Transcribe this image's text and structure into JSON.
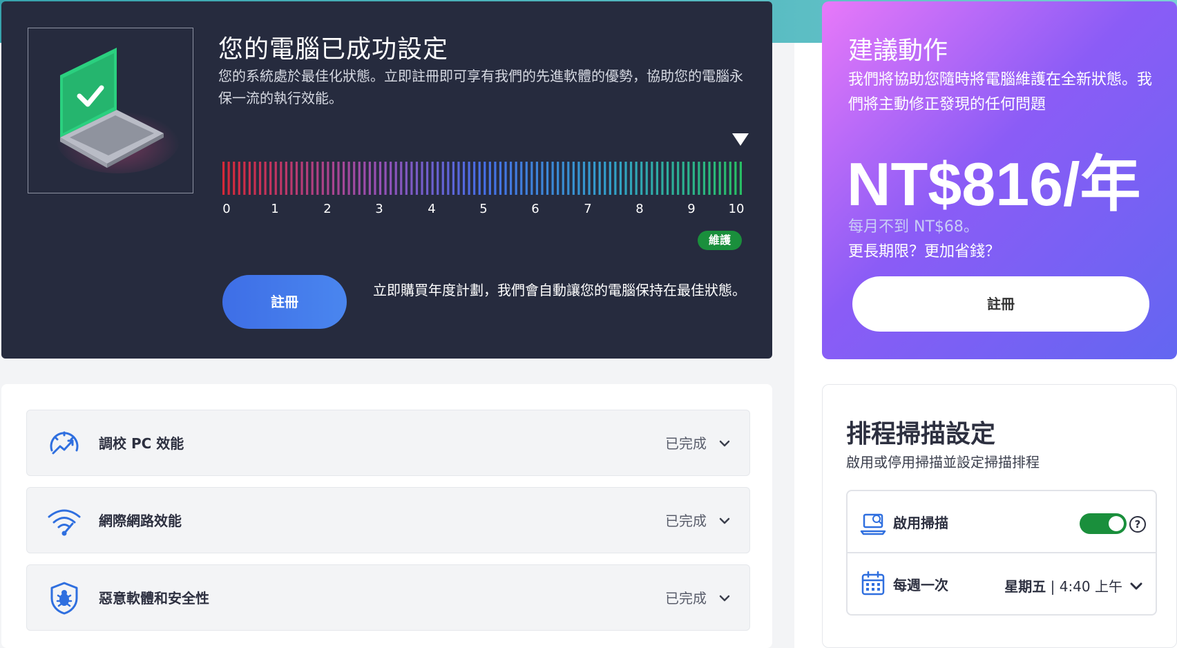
{
  "hero": {
    "title": "您的電腦已成功設定",
    "description": "您的系統處於最佳化狀態。立即註冊即可享有我們的先進軟體的優勢，協助您的電腦永保一流的執行效能。",
    "gauge_ticks": [
      "0",
      "1",
      "2",
      "3",
      "4",
      "5",
      "6",
      "7",
      "8",
      "9",
      "10"
    ],
    "status_badge": "維護",
    "register_button": "註冊",
    "note": "立即購買年度計劃，我們會自動讓您的電腦保持在最佳狀態。"
  },
  "promo": {
    "title": "建議動作",
    "description": "我們將協助您隨時將電腦維護在全新狀態。我們將主動修正發現的任何問題",
    "price": "NT$816/年",
    "monthly": "每月不到 NT$68。",
    "longer": "更長期限？更加省錢？",
    "register_button": "註冊"
  },
  "optimizations": [
    {
      "label": "調校 PC 效能",
      "status": "已完成",
      "icon": "speedometer-icon"
    },
    {
      "label": "網際網路效能",
      "status": "已完成",
      "icon": "wifi-icon"
    },
    {
      "label": "惡意軟體和安全性",
      "status": "已完成",
      "icon": "shield-bug-icon"
    }
  ],
  "schedule": {
    "title": "排程掃描設定",
    "description": "啟用或停用掃描並設定掃描排程",
    "enable_label": "啟用掃描",
    "enabled": true,
    "frequency_label": "每週一次",
    "day": "星期五",
    "separator": "|",
    "time": "4:40 上午"
  },
  "colors": {
    "hero_bg": "#262b3e",
    "accent_blue": "#3e6ee6",
    "status_green": "#1a8f3c"
  }
}
